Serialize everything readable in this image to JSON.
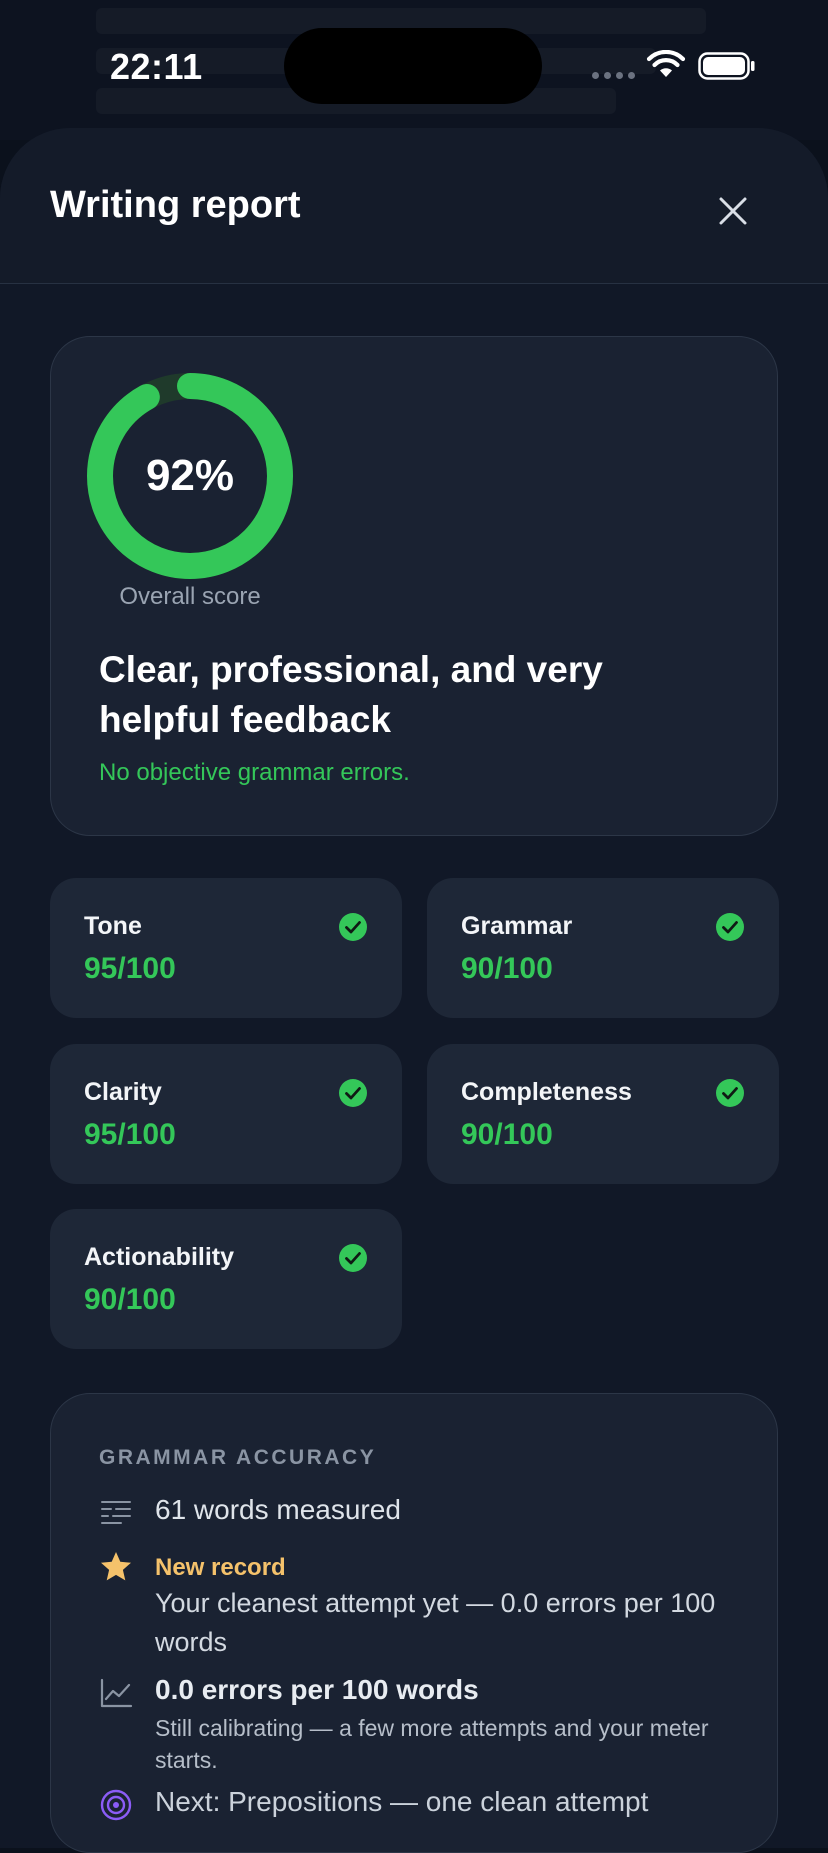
{
  "status_bar": {
    "time": "22:11"
  },
  "sheet": {
    "title": "Writing report"
  },
  "overall": {
    "score_text": "92%",
    "score_fraction": 0.92,
    "caption": "Overall score",
    "headline": "Clear, professional, and very helpful feedback",
    "subtext": "No objective grammar errors."
  },
  "metrics": [
    {
      "label": "Tone",
      "score": "95/100"
    },
    {
      "label": "Grammar",
      "score": "90/100"
    },
    {
      "label": "Clarity",
      "score": "95/100"
    },
    {
      "label": "Completeness",
      "score": "90/100"
    },
    {
      "label": "Actionability",
      "score": "90/100"
    }
  ],
  "grammar_accuracy": {
    "heading": "GRAMMAR ACCURACY",
    "words_measured": "61 words measured",
    "record_title": "New record",
    "record_body": "Your cleanest attempt yet — 0.0 errors per 100 words",
    "errors_title": "0.0 errors per 100 words",
    "errors_body": "Still calibrating — a few more attempts and your meter starts.",
    "next_text": "Next: Prepositions — one clean attempt"
  },
  "icons": {
    "close": "close-icon",
    "check": "check-circle-icon",
    "lines": "text-lines-icon",
    "star": "star-icon",
    "chart": "line-chart-icon",
    "target": "target-icon"
  },
  "colors": {
    "accent_green": "#34c759",
    "record_gold": "#f5c26b",
    "target_purple": "#8b5cf6"
  }
}
